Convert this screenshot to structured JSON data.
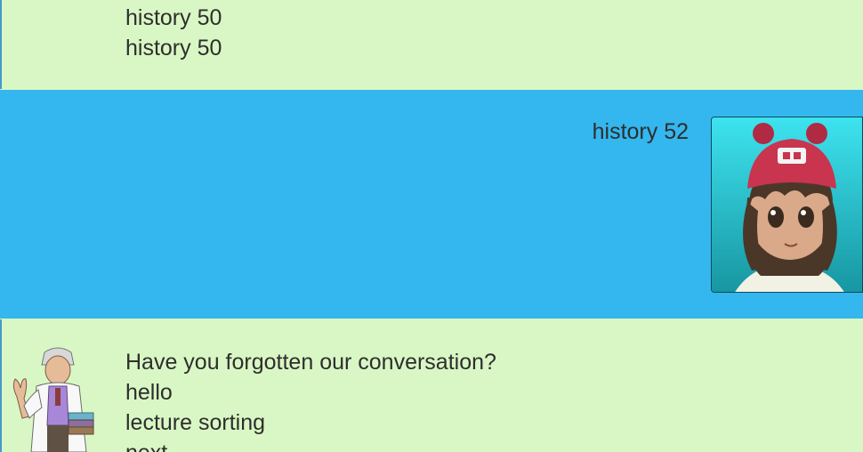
{
  "messages": [
    {
      "sender": "bot",
      "lines": [
        "history 50",
        "history 50"
      ]
    },
    {
      "sender": "user",
      "lines": [
        "history 52"
      ]
    },
    {
      "sender": "bot",
      "lines": [
        "Have you forgotten our conversation?",
        "hello",
        "lecture sorting",
        "next"
      ]
    }
  ],
  "colors": {
    "bot_background": "#d9f7c4",
    "user_background": "#34b6ee",
    "text": "#2e2e2e",
    "user_hat": "#c9344f",
    "user_skin": "#d9a98a",
    "user_hair": "#4b3728"
  },
  "avatars": {
    "user": "girl-trainer-avatar",
    "bot": "professor-avatar"
  }
}
